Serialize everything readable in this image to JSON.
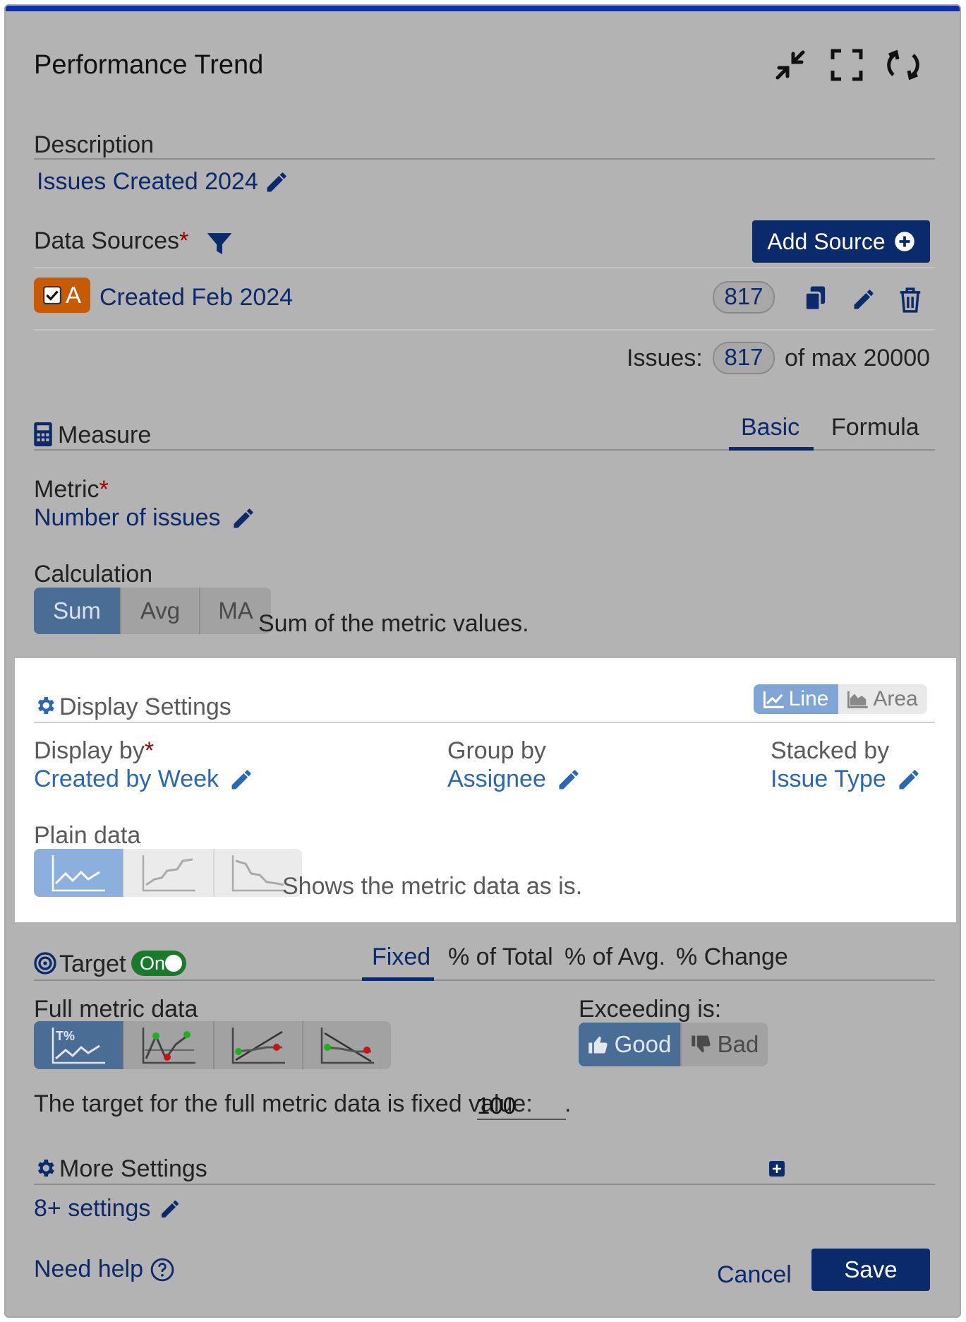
{
  "header": {
    "title": "Performance Trend"
  },
  "description": {
    "label": "Description",
    "value": "Issues Created 2024"
  },
  "data_sources": {
    "label": "Data Sources",
    "add_label": "Add Source",
    "source": {
      "letter": "A",
      "name": "Created Feb 2024",
      "count": "817"
    },
    "issues_label": "Issues:",
    "issues_count": "817",
    "issues_max": "of max 20000"
  },
  "measure": {
    "label": "Measure",
    "tabs": [
      "Basic",
      "Formula"
    ],
    "metric_label": "Metric",
    "metric_value": "Number of issues",
    "calc_label": "Calculation",
    "calc_options": [
      "Sum",
      "Avg",
      "MA"
    ],
    "calc_desc": "Sum of the metric values."
  },
  "display": {
    "label": "Display Settings",
    "chart_types": [
      "Line",
      "Area"
    ],
    "display_by_label": "Display by",
    "display_by_value": "Created by Week",
    "group_by_label": "Group by",
    "group_by_value": "Assignee",
    "stacked_by_label": "Stacked by",
    "stacked_by_value": "Issue Type",
    "plain_label": "Plain data",
    "plain_desc": "Shows the metric data as is."
  },
  "target": {
    "label": "Target",
    "toggle": "On",
    "tabs": [
      "Fixed",
      "% of Total",
      "% of Avg.",
      "% Change"
    ],
    "full_label": "Full metric data",
    "exceeding_label": "Exceeding is:",
    "good": "Good",
    "bad": "Bad",
    "fixed_text": "The target for the full metric data is fixed value:",
    "fixed_value": "100",
    "period": "."
  },
  "more": {
    "label": "More Settings",
    "link": "8+ settings"
  },
  "footer": {
    "help": "Need help",
    "cancel": "Cancel",
    "save": "Save"
  },
  "colors": {
    "accent": "#0b2a6b",
    "top_bar": "#0b2fb3",
    "source_badge": "#c85a00",
    "toggle_on": "#1a7a2c"
  }
}
